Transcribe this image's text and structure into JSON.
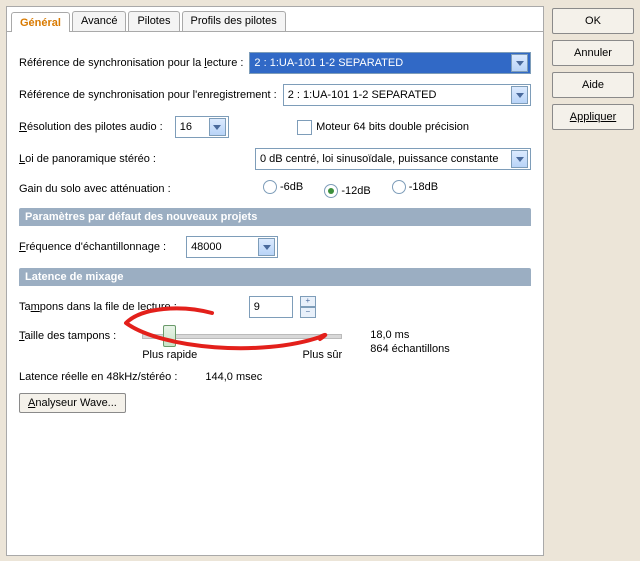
{
  "side_buttons": {
    "ok": "OK",
    "cancel": "Annuler",
    "help": "Aide",
    "apply": "Appliquer"
  },
  "tabs": {
    "general": "Général",
    "advanced": "Avancé",
    "drivers": "Pilotes",
    "profiles": "Profils des pilotes"
  },
  "playback_sync": {
    "label_pre": "Référence de synchronisation pour la ",
    "label_u": "l",
    "label_post": "ecture :",
    "value": "2 : 1:UA-101 1-2 SEPARATED"
  },
  "record_sync": {
    "label": "Référence de synchronisation pour l'enregistrement :",
    "value": "2 : 1:UA-101 1-2 SEPARATED"
  },
  "bit_depth": {
    "label_u": "R",
    "label_post": "ésolution des pilotes audio :",
    "value": "16"
  },
  "engine64": {
    "label": "Moteur 64 bits double précision"
  },
  "pan_law": {
    "label_u": "L",
    "label_post": "oi de panoramique stéréo :",
    "value": "0 dB centré, loi sinusoïdale, puissance constante"
  },
  "solo_gain": {
    "label": "Gain du solo avec atténuation :",
    "opts": [
      "-6dB",
      "-12dB",
      "-18dB"
    ],
    "selected": 1
  },
  "section_defaults": "Paramètres par défaut des nouveaux projets",
  "sample_rate": {
    "label_u": "F",
    "label_post": "réquence d'échantillonnage :",
    "value": "48000"
  },
  "section_latency": "Latence de mixage",
  "queue_buffers": {
    "label_pre": "Ta",
    "label_u": "m",
    "label_post": "pons dans la file de lecture :",
    "value": "9"
  },
  "buffer_size": {
    "label_u": "T",
    "label_post": "aille des tampons :",
    "ms": "18,0 ms",
    "samples": "864 échantillons",
    "faster": "Plus rapide",
    "safer": "Plus sûr"
  },
  "eff_latency": {
    "label": "Latence réelle en 48kHz/stéréo :",
    "value": "144,0 msec"
  },
  "wave_btn": {
    "label_u": "A",
    "label_post": "nalyseur Wave..."
  }
}
